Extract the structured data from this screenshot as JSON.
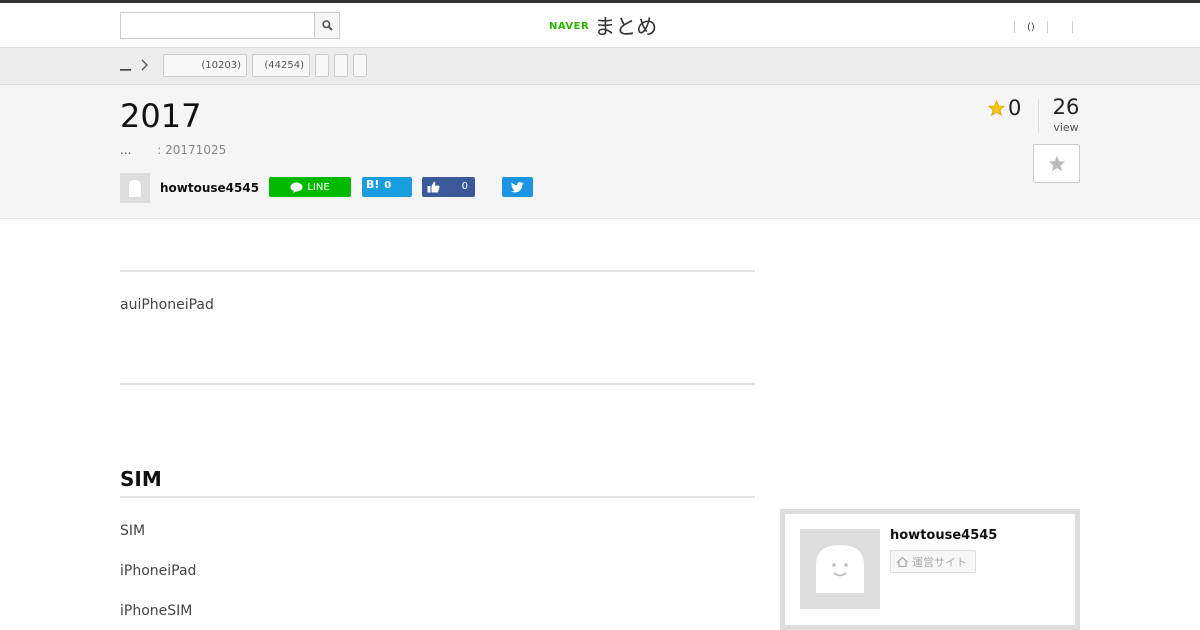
{
  "header": {
    "search": {
      "placeholder": "",
      "value": ""
    },
    "logo": {
      "naver": "NAVER",
      "matome": "まとめ"
    },
    "right_link": "()"
  },
  "breadcrumb": {
    "home": "__",
    "tags": [
      {
        "label": "(10203)"
      },
      {
        "label": "(44254)"
      },
      {
        "label": ""
      },
      {
        "label": ""
      },
      {
        "label": ""
      }
    ]
  },
  "article": {
    "title": "2017",
    "meta_prefix": "...",
    "meta_date": ": 20171025",
    "author": "howtouse4545",
    "share": {
      "line_label": "LINE",
      "hatena_label": "B!",
      "hatena_count": "0",
      "fb_count": "0"
    },
    "favorites": "0",
    "views": "26",
    "views_label": "view"
  },
  "content": {
    "intro": "auiPhoneiPad",
    "section_title": "SIM",
    "paragraphs": [
      "SIM",
      "iPhoneiPad",
      "iPhoneSIM"
    ]
  },
  "sidebar": {
    "profile_name": "howtouse4545",
    "profile_site": "運営サイト"
  },
  "colors": {
    "line_green": "#00b900",
    "hatena_blue": "#1a9ee0",
    "facebook_blue": "#3b5998",
    "twitter_blue": "#1b95e0",
    "naver_green": "#2db400",
    "star_gold": "#f5c518"
  }
}
